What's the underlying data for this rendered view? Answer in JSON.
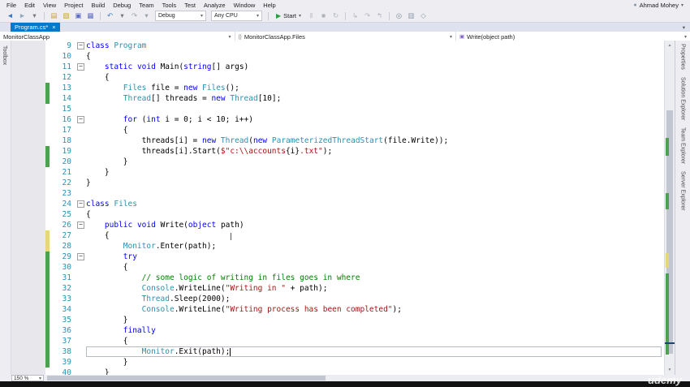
{
  "window": {
    "user": "Ahmad Mohey"
  },
  "icons": {
    "close": "×",
    "chevron": "▾",
    "user": "●",
    "braces": "{}",
    "method": "▣"
  },
  "menu": {
    "items": [
      "File",
      "Edit",
      "View",
      "Project",
      "Build",
      "Debug",
      "Team",
      "Tools",
      "Test",
      "Analyze",
      "Window",
      "Help"
    ]
  },
  "toolbar": {
    "items": [
      {
        "type": "icon",
        "name": "back-icon",
        "glyph": "◄",
        "color": "#3E79C7"
      },
      {
        "type": "icon",
        "name": "forward-icon",
        "glyph": "►",
        "color": "#94A7BD"
      },
      {
        "type": "icon",
        "name": "nav-history-dropdown-icon",
        "glyph": "▾",
        "color": "#777777"
      },
      {
        "type": "sep"
      },
      {
        "type": "icon",
        "name": "new-file-icon",
        "glyph": "▤",
        "color": "#C9A227"
      },
      {
        "type": "icon",
        "name": "open-file-icon",
        "glyph": "▧",
        "color": "#C9A227"
      },
      {
        "type": "icon",
        "name": "save-icon",
        "glyph": "▣",
        "color": "#5C6BC0"
      },
      {
        "type": "icon",
        "name": "save-all-icon",
        "glyph": "▦",
        "color": "#5C6BC0"
      },
      {
        "type": "sep"
      },
      {
        "type": "icon",
        "name": "undo-icon",
        "glyph": "↶",
        "color": "#3E79C7"
      },
      {
        "type": "icon",
        "name": "undo-dropdown-icon",
        "glyph": "▾",
        "color": "#777777"
      },
      {
        "type": "icon",
        "name": "redo-icon",
        "glyph": "↷",
        "color": "#9AA0A6"
      },
      {
        "type": "icon",
        "name": "redo-dropdown-icon",
        "glyph": "▾",
        "color": "#9AA0A6"
      },
      {
        "type": "dropdown",
        "name": "configuration-dropdown",
        "label": "Debug"
      },
      {
        "type": "dropdown",
        "name": "platform-dropdown",
        "label": "Any CPU"
      },
      {
        "type": "sep"
      },
      {
        "type": "start",
        "name": "start-debugging-button",
        "label": "Start"
      },
      {
        "type": "icon",
        "name": "pause-icon",
        "glyph": "‖",
        "color": "#B0B4BA"
      },
      {
        "type": "icon",
        "name": "stop-icon",
        "glyph": "■",
        "color": "#B0B4BA"
      },
      {
        "type": "icon",
        "name": "restart-icon",
        "glyph": "↻",
        "color": "#B0B4BA"
      },
      {
        "type": "sep"
      },
      {
        "type": "icon",
        "name": "step-into-icon",
        "glyph": "↳",
        "color": "#B0B4BA"
      },
      {
        "type": "icon",
        "name": "step-over-icon",
        "glyph": "↷",
        "color": "#B0B4BA"
      },
      {
        "type": "icon",
        "name": "step-out-icon",
        "glyph": "↰",
        "color": "#B0B4BA"
      },
      {
        "type": "sep"
      },
      {
        "type": "icon",
        "name": "find-in-files-icon",
        "glyph": "◎",
        "color": "#8B97A5"
      },
      {
        "type": "icon",
        "name": "comment-icon",
        "glyph": "▥",
        "color": "#8B97A5"
      },
      {
        "type": "icon",
        "name": "bookmark-icon",
        "glyph": "◇",
        "color": "#8B97A5"
      }
    ]
  },
  "tabs": {
    "active": "Program.cs*"
  },
  "breadcrumb": {
    "project": "MonitorClassApp",
    "type": "MonitorClassApp.Files",
    "member": "Write(object path)"
  },
  "side_panels": {
    "left": [
      "Toolbox"
    ],
    "right": [
      "Properties",
      "Solution Explorer",
      "Team Explorer",
      "Server Explorer"
    ]
  },
  "statusbar": {
    "zoom": "150 %"
  },
  "watermark": "udemy",
  "colors": {
    "tab_active_bg": "#007ACC",
    "keyword": "#0000FF",
    "type": "#2B91AF",
    "string": "#A31515",
    "comment": "#008000",
    "line_number": "#2B91AF",
    "track_saved": "#4FA14F",
    "track_unsaved": "#E5D87A"
  },
  "editor": {
    "lines": [
      {
        "n": 9,
        "fold": true,
        "segs": [
          [
            "class",
            "kw"
          ],
          [
            " ",
            "p"
          ],
          [
            "Program",
            "ty"
          ]
        ]
      },
      {
        "n": 10,
        "segs": [
          [
            "{",
            "p"
          ]
        ]
      },
      {
        "n": 11,
        "fold": true,
        "segs": [
          [
            "    ",
            "p"
          ],
          [
            "static",
            "kw"
          ],
          [
            " ",
            "p"
          ],
          [
            "void",
            "kw"
          ],
          [
            " Main(",
            "p"
          ],
          [
            "string",
            "kw"
          ],
          [
            "[] args)",
            "p"
          ]
        ]
      },
      {
        "n": 12,
        "segs": [
          [
            "    {",
            "p"
          ]
        ]
      },
      {
        "n": 13,
        "track": "green",
        "segs": [
          [
            "        ",
            "p"
          ],
          [
            "Files",
            "ty"
          ],
          [
            " file = ",
            "p"
          ],
          [
            "new",
            "kw"
          ],
          [
            " ",
            "p"
          ],
          [
            "Files",
            "ty"
          ],
          [
            "();",
            "p"
          ]
        ]
      },
      {
        "n": 14,
        "track": "green",
        "segs": [
          [
            "        ",
            "p"
          ],
          [
            "Thread",
            "ty"
          ],
          [
            "[] threads = ",
            "p"
          ],
          [
            "new",
            "kw"
          ],
          [
            " ",
            "p"
          ],
          [
            "Thread",
            "ty"
          ],
          [
            "[10];",
            "p"
          ]
        ]
      },
      {
        "n": 15,
        "segs": []
      },
      {
        "n": 16,
        "fold": true,
        "segs": [
          [
            "        ",
            "p"
          ],
          [
            "for",
            "kw"
          ],
          [
            " (",
            "p"
          ],
          [
            "int",
            "kw"
          ],
          [
            " i = 0; i < 10; i++)",
            "p"
          ]
        ]
      },
      {
        "n": 17,
        "segs": [
          [
            "        {",
            "p"
          ]
        ]
      },
      {
        "n": 18,
        "segs": [
          [
            "            threads[i] = ",
            "p"
          ],
          [
            "new",
            "kw"
          ],
          [
            " ",
            "p"
          ],
          [
            "Thread",
            "ty"
          ],
          [
            "(",
            "p"
          ],
          [
            "new",
            "kw"
          ],
          [
            " ",
            "p"
          ],
          [
            "ParameterizedThreadStart",
            "ty"
          ],
          [
            "(file.Write));",
            "p"
          ]
        ]
      },
      {
        "n": 19,
        "track": "green",
        "segs": [
          [
            "            threads[i].Start(",
            "p"
          ],
          [
            "$\"c:\\\\accounts",
            "st"
          ],
          [
            "{i}",
            "p"
          ],
          [
            ".txt\"",
            "st"
          ],
          [
            ");",
            "p"
          ]
        ]
      },
      {
        "n": 20,
        "track": "green",
        "segs": [
          [
            "        }",
            "p"
          ]
        ]
      },
      {
        "n": 21,
        "segs": [
          [
            "    }",
            "p"
          ]
        ]
      },
      {
        "n": 22,
        "segs": [
          [
            "}",
            "p"
          ]
        ]
      },
      {
        "n": 23,
        "segs": []
      },
      {
        "n": 24,
        "fold": true,
        "segs": [
          [
            "class",
            "kw"
          ],
          [
            " ",
            "p"
          ],
          [
            "Files",
            "ty"
          ]
        ]
      },
      {
        "n": 25,
        "segs": [
          [
            "{",
            "p"
          ]
        ]
      },
      {
        "n": 26,
        "fold": true,
        "segs": [
          [
            "    ",
            "p"
          ],
          [
            "public",
            "kw"
          ],
          [
            " ",
            "p"
          ],
          [
            "void",
            "kw"
          ],
          [
            " Write(",
            "p"
          ],
          [
            "object",
            "kw"
          ],
          [
            " path)",
            "p"
          ]
        ]
      },
      {
        "n": 27,
        "track": "yellow",
        "segs": [
          [
            "    {",
            "p"
          ]
        ]
      },
      {
        "n": 28,
        "track": "yellow",
        "segs": [
          [
            "        ",
            "p"
          ],
          [
            "Monitor",
            "ty"
          ],
          [
            ".Enter(path);",
            "p"
          ]
        ]
      },
      {
        "n": 29,
        "fold": true,
        "track": "green",
        "segs": [
          [
            "        ",
            "p"
          ],
          [
            "try",
            "kw"
          ]
        ]
      },
      {
        "n": 30,
        "track": "green",
        "segs": [
          [
            "        {",
            "p"
          ]
        ]
      },
      {
        "n": 31,
        "track": "green",
        "segs": [
          [
            "            ",
            "p"
          ],
          [
            "// some logic of writing in files goes in where",
            "cm"
          ]
        ]
      },
      {
        "n": 32,
        "track": "green",
        "segs": [
          [
            "            ",
            "p"
          ],
          [
            "Console",
            "ty"
          ],
          [
            ".WriteLine(",
            "p"
          ],
          [
            "\"Writing in \"",
            "st"
          ],
          [
            " + path);",
            "p"
          ]
        ]
      },
      {
        "n": 33,
        "track": "green",
        "segs": [
          [
            "            ",
            "p"
          ],
          [
            "Thread",
            "ty"
          ],
          [
            ".Sleep(2000);",
            "p"
          ]
        ]
      },
      {
        "n": 34,
        "track": "green",
        "segs": [
          [
            "            ",
            "p"
          ],
          [
            "Console",
            "ty"
          ],
          [
            ".WriteLine(",
            "p"
          ],
          [
            "\"Writing process has been completed\"",
            "st"
          ],
          [
            ");",
            "p"
          ]
        ]
      },
      {
        "n": 35,
        "track": "green",
        "segs": [
          [
            "        }",
            "p"
          ]
        ]
      },
      {
        "n": 36,
        "track": "green",
        "segs": [
          [
            "        ",
            "p"
          ],
          [
            "finally",
            "kw"
          ]
        ]
      },
      {
        "n": 37,
        "track": "green",
        "segs": [
          [
            "        {",
            "p"
          ]
        ]
      },
      {
        "n": 38,
        "track": "green",
        "cur": true,
        "caret": true,
        "segs": [
          [
            "            ",
            "p"
          ],
          [
            "Monitor",
            "ty"
          ],
          [
            ".Exit(path);",
            "p"
          ]
        ]
      },
      {
        "n": 39,
        "track": "green",
        "segs": [
          [
            "        }",
            "p"
          ]
        ]
      },
      {
        "n": 40,
        "segs": [
          [
            "    }",
            "p"
          ]
        ]
      }
    ]
  }
}
